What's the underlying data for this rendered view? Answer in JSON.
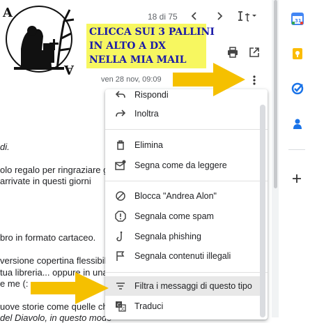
{
  "email": {
    "lines": [
      {
        "text": "di.",
        "italic": true
      },
      {
        "text": "olo regalo per ringraziare gli"
      },
      {
        "text": " arrivate in questi giorni"
      },
      {
        "text": "bro in formato cartaceo."
      },
      {
        "text": "versione copertina flessibile"
      },
      {
        "text": "tua libreria... oppure in una"
      },
      {
        "text": "e me (:"
      },
      {
        "text": "uove storie come quelle che"
      },
      {
        "text": "del Diavolo, in questo modo"
      }
    ]
  },
  "header": {
    "pager": "18 di 75",
    "prev_icon": "chevron-left-icon",
    "next_icon": "chevron-right-icon",
    "input_tools_icon": "input-tools-icon",
    "print_icon": "print-icon",
    "open_new_window_icon": "open-in-new-icon"
  },
  "instruction": {
    "lines": [
      "CLICCA SUI 3 PALLINI",
      "IN ALTO A DX",
      "NELLA MIA MAIL"
    ]
  },
  "message": {
    "date": "ven 28 nov, 09:09"
  },
  "menu": {
    "items": [
      {
        "label": "Rispondi",
        "icon": "reply-icon"
      },
      {
        "label": "Inoltra",
        "icon": "forward-icon"
      },
      {
        "label": "Elimina",
        "icon": "trash-icon"
      },
      {
        "label": "Segna come da leggere",
        "icon": "mark-unread-icon"
      },
      {
        "label": "Blocca \"Andrea Alon\"",
        "icon": "block-icon"
      },
      {
        "label": "Segnala come spam",
        "icon": "spam-icon"
      },
      {
        "label": "Segnala phishing",
        "icon": "phishing-icon"
      },
      {
        "label": "Segnala contenuti illegali",
        "icon": "flag-icon"
      },
      {
        "label": "Filtra i messaggi di questo tipo",
        "icon": "filter-icon",
        "highlighted": true
      },
      {
        "label": "Traduci",
        "icon": "translate-icon"
      }
    ]
  },
  "rail": {
    "apps": [
      "calendar-icon",
      "keep-icon",
      "tasks-icon",
      "contacts-icon"
    ],
    "add_icon": "add-icon"
  },
  "colors": {
    "highlight_yellow": "#f7f760",
    "instruction_text": "#1a1aa8",
    "arrow_yellow": "#f5c000"
  }
}
